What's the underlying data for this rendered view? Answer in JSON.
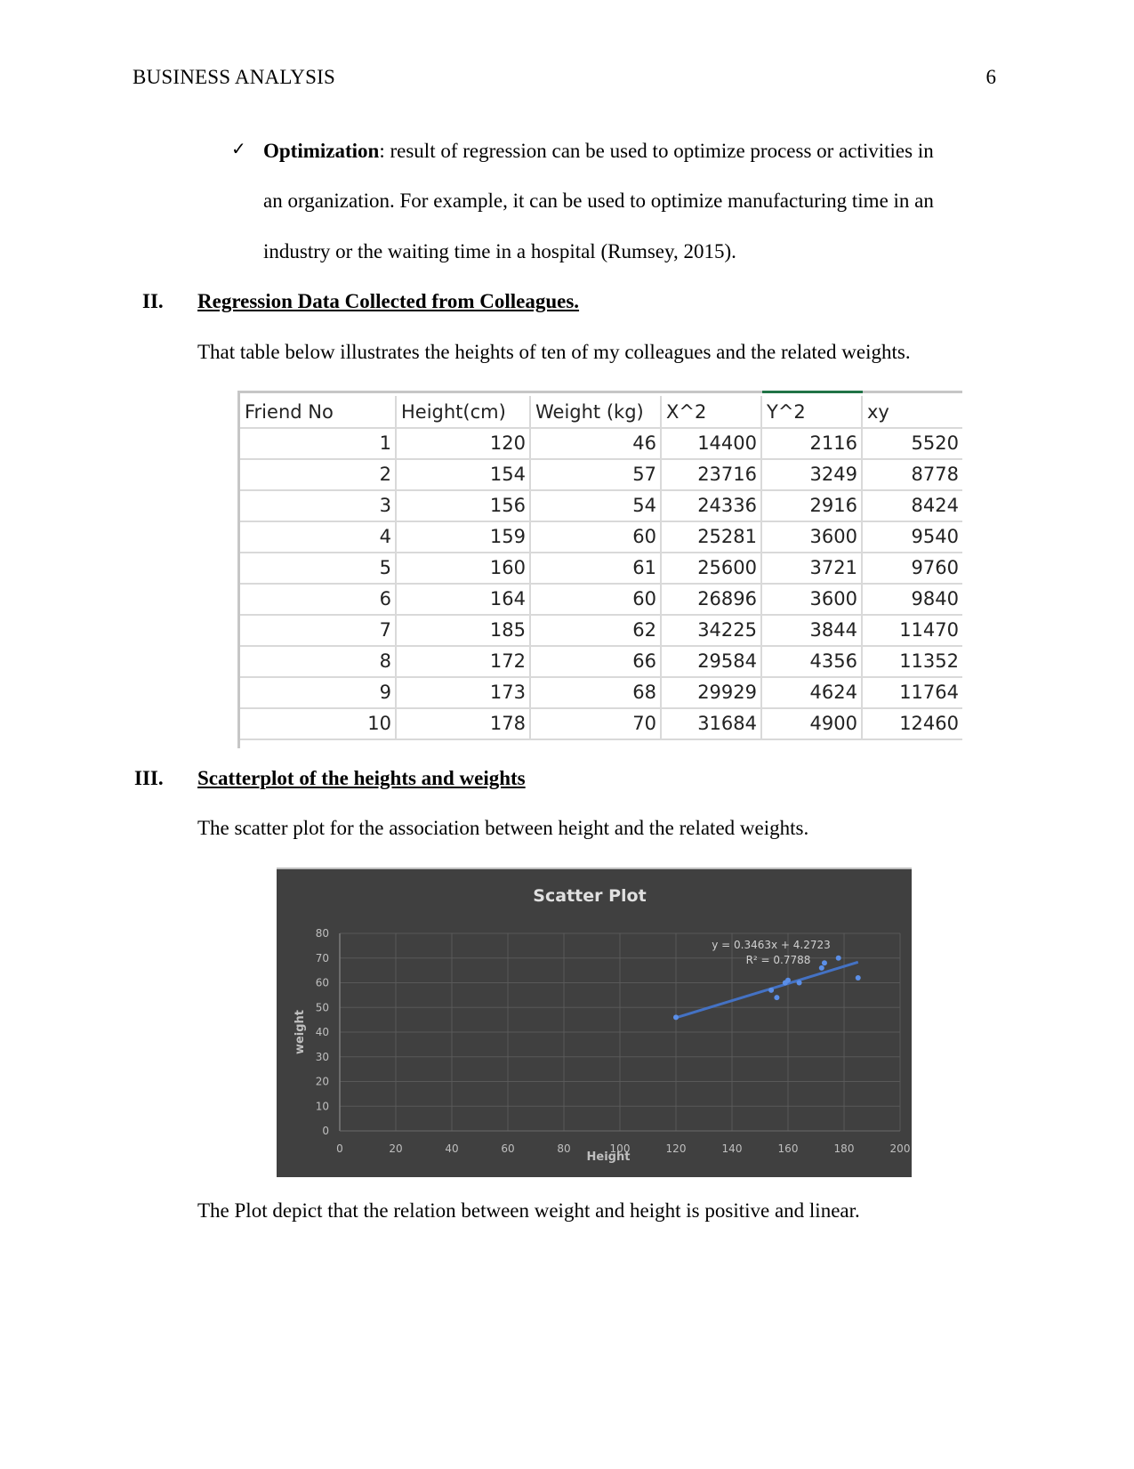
{
  "header": {
    "running_head": "BUSINESS ANALYSIS",
    "page_number": "6"
  },
  "bullet": {
    "icon": "checkmark-icon",
    "glyph": "✓",
    "term": "Optimization",
    "line1_rest": ": result of regression can be used to optimize process or activities in",
    "line2": "an organization. For example, it can be used to optimize manufacturing time in an",
    "line3": "industry or the waiting time in a hospital (Rumsey, 2015)."
  },
  "section2": {
    "number": "II.",
    "title": "Regression Data Collected from Colleagues.",
    "intro": "That table below illustrates the heights of ten of my colleagues and the related weights."
  },
  "table": {
    "columns": [
      "Friend No",
      "Height(cm)",
      "Weight (kg)",
      "X^2",
      "Y^2",
      "xy"
    ],
    "rows": [
      [
        "1",
        "120",
        "46",
        "14400",
        "2116",
        "5520"
      ],
      [
        "2",
        "154",
        "57",
        "23716",
        "3249",
        "8778"
      ],
      [
        "3",
        "156",
        "54",
        "24336",
        "2916",
        "8424"
      ],
      [
        "4",
        "159",
        "60",
        "25281",
        "3600",
        "9540"
      ],
      [
        "5",
        "160",
        "61",
        "25600",
        "3721",
        "9760"
      ],
      [
        "6",
        "164",
        "60",
        "26896",
        "3600",
        "9840"
      ],
      [
        "7",
        "185",
        "62",
        "34225",
        "3844",
        "11470"
      ],
      [
        "8",
        "172",
        "66",
        "29584",
        "4356",
        "11352"
      ],
      [
        "9",
        "173",
        "68",
        "29929",
        "4624",
        "11764"
      ],
      [
        "10",
        "178",
        "70",
        "31684",
        "4900",
        "12460"
      ]
    ]
  },
  "section3": {
    "number": "III.",
    "title": "Scatterplot of the heights and weights",
    "intro": "The scatter plot for the association between height and the related weights."
  },
  "conclusion": "The Plot depict that the relation between weight and height is positive and linear.",
  "chart_data": {
    "type": "scatter",
    "title": "Scatter Plot",
    "xlabel": "Height",
    "ylabel": "weight",
    "xlim": [
      0,
      200
    ],
    "ylim": [
      0,
      80
    ],
    "xticks": [
      0,
      20,
      40,
      60,
      80,
      100,
      120,
      140,
      160,
      180,
      200
    ],
    "yticks": [
      0,
      10,
      20,
      30,
      40,
      50,
      60,
      70,
      80
    ],
    "grid": true,
    "series": [
      {
        "name": "weight",
        "x": [
          120,
          154,
          156,
          159,
          160,
          164,
          185,
          172,
          173,
          178
        ],
        "y": [
          46,
          57,
          54,
          60,
          61,
          60,
          62,
          66,
          68,
          70
        ]
      }
    ],
    "trendline": {
      "type": "linear",
      "slope": 0.3463,
      "intercept": 4.2723,
      "x_range": [
        120,
        185
      ],
      "equation_label": "y = 0.3463x + 4.2723",
      "r2_label": "R² = 0.7788"
    },
    "colors": {
      "background": "#404040",
      "grid": "#595959",
      "text": "#bfbfbf",
      "title": "#e0e0e0",
      "marker": "#5b8fe8",
      "trendline": "#4472c4"
    }
  }
}
